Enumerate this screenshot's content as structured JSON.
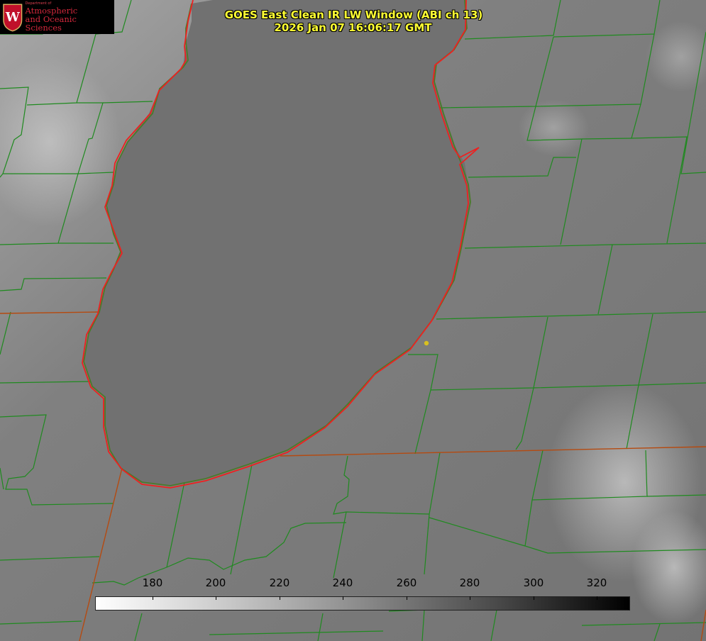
{
  "title": {
    "line1": "GOES East Clean IR LW Window (ABI ch 13)",
    "line2": "2026 Jan 07 16:06:17 GMT"
  },
  "logo": {
    "dept": "Department of",
    "line1": "Atmospheric",
    "line2": "and Oceanic Sciences",
    "crest_letter": "W"
  },
  "colorbar": {
    "ticks": [
      "180",
      "200",
      "220",
      "240",
      "260",
      "280",
      "300",
      "320"
    ]
  },
  "colors": {
    "boundary_county": "#1f8a1f",
    "boundary_lake": "#ee2020",
    "boundary_state": "#b54a10",
    "marker": "#d8c020",
    "title_text": "#ffff33"
  }
}
